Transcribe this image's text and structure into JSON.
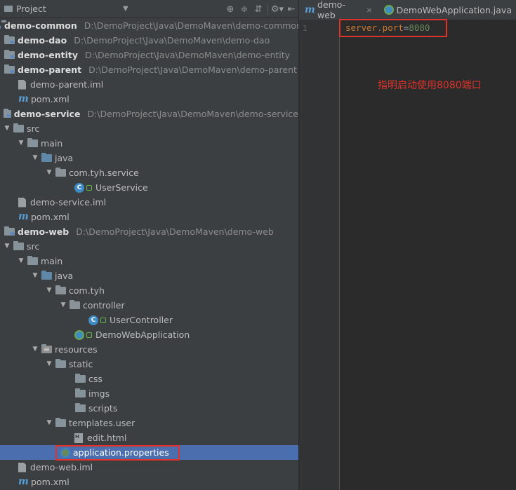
{
  "project_panel": {
    "title": "Project",
    "tools": [
      "target-icon",
      "collapse-icon",
      "gear-icon",
      "hide-icon"
    ]
  },
  "tree": [
    {
      "id": "r0",
      "label": "demo-common",
      "path": "D:\\DemoProject\\Java\\DemoMaven\\demo-common",
      "type": "module",
      "depth": 0,
      "arrow": "",
      "bold": true
    },
    {
      "id": "r1",
      "label": "demo-dao",
      "path": "D:\\DemoProject\\Java\\DemoMaven\\demo-dao",
      "type": "module",
      "depth": 0,
      "arrow": "",
      "bold": true
    },
    {
      "id": "r2",
      "label": "demo-entity",
      "path": "D:\\DemoProject\\Java\\DemoMaven\\demo-entity",
      "type": "module",
      "depth": 0,
      "arrow": "",
      "bold": true
    },
    {
      "id": "r3",
      "label": "demo-parent",
      "path": "D:\\DemoProject\\Java\\DemoMaven\\demo-parent",
      "type": "module",
      "depth": 0,
      "arrow": "",
      "bold": true
    },
    {
      "id": "r4",
      "label": "demo-parent.iml",
      "type": "file",
      "depth": 1
    },
    {
      "id": "r5",
      "label": "pom.xml",
      "type": "maven",
      "depth": 1
    },
    {
      "id": "r6",
      "label": "demo-service",
      "path": "D:\\DemoProject\\Java\\DemoMaven\\demo-service",
      "type": "module",
      "depth": 0,
      "arrow": "",
      "bold": true
    },
    {
      "id": "r7",
      "label": "src",
      "type": "folder",
      "depth": 0,
      "arrow": "▼"
    },
    {
      "id": "r8",
      "label": "main",
      "type": "folder",
      "depth": 1,
      "arrow": "▼"
    },
    {
      "id": "r9",
      "label": "java",
      "type": "src",
      "depth": 2,
      "arrow": "▼"
    },
    {
      "id": "r10",
      "label": "com.tyh.service",
      "type": "pkg",
      "depth": 3,
      "arrow": "▼"
    },
    {
      "id": "r11",
      "label": "UserService",
      "type": "class",
      "depth": 5
    },
    {
      "id": "r12",
      "label": "demo-service.iml",
      "type": "file",
      "depth": 1
    },
    {
      "id": "r13",
      "label": "pom.xml",
      "type": "maven",
      "depth": 1
    },
    {
      "id": "r14",
      "label": "demo-web",
      "path": "D:\\DemoProject\\Java\\DemoMaven\\demo-web",
      "type": "module",
      "depth": 0,
      "arrow": "",
      "bold": true
    },
    {
      "id": "r15",
      "label": "src",
      "type": "folder",
      "depth": 0,
      "arrow": "▼"
    },
    {
      "id": "r16",
      "label": "main",
      "type": "folder",
      "depth": 1,
      "arrow": "▼"
    },
    {
      "id": "r17",
      "label": "java",
      "type": "src",
      "depth": 2,
      "arrow": "▼"
    },
    {
      "id": "r18",
      "label": "com.tyh",
      "type": "pkg",
      "depth": 3,
      "arrow": "▼"
    },
    {
      "id": "r19",
      "label": "controller",
      "type": "pkg",
      "depth": 4,
      "arrow": "▼"
    },
    {
      "id": "r20",
      "label": "UserController",
      "type": "class",
      "depth": 6
    },
    {
      "id": "r21",
      "label": "DemoWebApplication",
      "type": "spring",
      "depth": 5
    },
    {
      "id": "r22",
      "label": "resources",
      "type": "res",
      "depth": 2,
      "arrow": "▼"
    },
    {
      "id": "r23",
      "label": "static",
      "type": "folder",
      "depth": 3,
      "arrow": "▼"
    },
    {
      "id": "r24",
      "label": "css",
      "type": "folder",
      "depth": 5
    },
    {
      "id": "r25",
      "label": "imgs",
      "type": "folder",
      "depth": 5
    },
    {
      "id": "r26",
      "label": "scripts",
      "type": "folder",
      "depth": 5
    },
    {
      "id": "r27",
      "label": "templates.user",
      "type": "folder",
      "depth": 3,
      "arrow": "▼"
    },
    {
      "id": "r28",
      "label": "edit.html",
      "type": "html",
      "depth": 5
    },
    {
      "id": "r29",
      "label": "application.properties",
      "type": "props",
      "depth": 4,
      "selected": true
    },
    {
      "id": "r30",
      "label": "demo-web.iml",
      "type": "file",
      "depth": 1
    },
    {
      "id": "r31",
      "label": "pom.xml",
      "type": "maven",
      "depth": 1
    }
  ],
  "editor": {
    "tabs": [
      {
        "label": "demo-web",
        "icon": "maven-icon",
        "close": "×"
      },
      {
        "label": "DemoWebApplication.java",
        "icon": "spring-class-icon",
        "close": ""
      }
    ],
    "line_number": "1",
    "code": {
      "key": "server.port",
      "eq": "=",
      "value": "8080"
    },
    "annotation": "指明启动使用8080端口"
  },
  "colors": {
    "panel_bg": "#3c3f41",
    "editor_bg": "#2b2b2b",
    "selection": "#4b6eaf",
    "highlight": "#e0322b"
  }
}
